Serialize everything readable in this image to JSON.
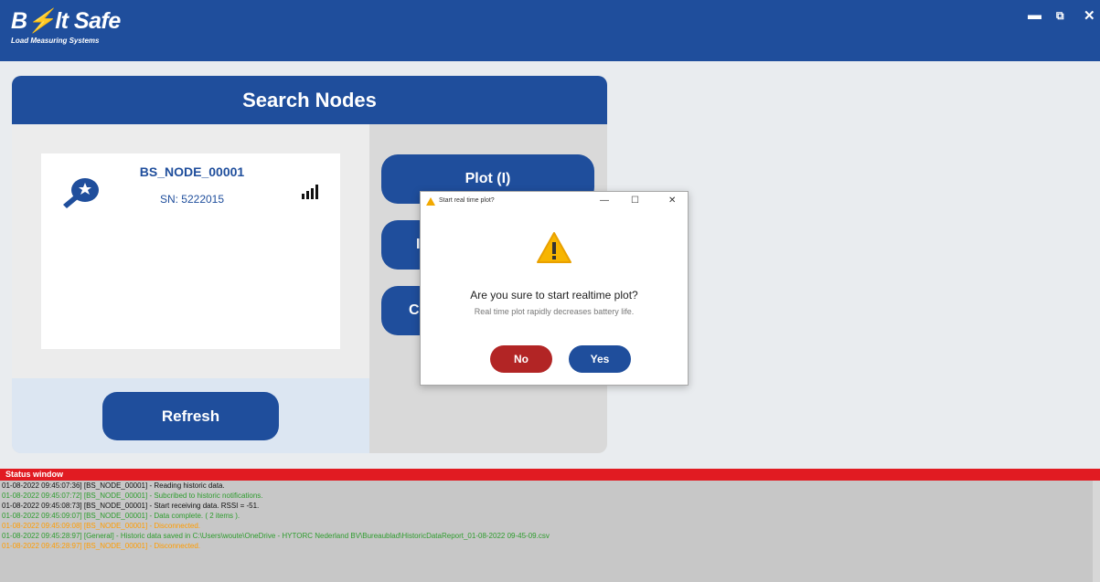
{
  "app": {
    "logo_prefix": "B",
    "logo_suffix": "lt Safe",
    "logo_subtitle": "Load Measuring Systems",
    "window_controls": {
      "minimize": "▬",
      "restore": "⧉",
      "close": "✕"
    }
  },
  "panel": {
    "title": "Search Nodes",
    "node": {
      "name": "BS_NODE_00001",
      "sn": "SN: 5222015",
      "icon": "sensor-node-icon",
      "signal_icon": "signal-strength-icon"
    },
    "refresh_label": "Refresh",
    "buttons": {
      "plot": "Plot (I)",
      "second": "I",
      "third": "C"
    }
  },
  "dialog": {
    "title": "Start real time plot?",
    "question": "Are you sure to start realtime plot?",
    "detail": "Real time plot rapidly decreases battery life.",
    "no_label": "No",
    "yes_label": "Yes",
    "controls": {
      "minimize": "—",
      "maximize": "☐",
      "close": "✕"
    }
  },
  "status": {
    "title": "Status window",
    "lines": [
      {
        "text": "01-08-2022 09:45:07:36] [BS_NODE_00001] - Reading historic data.",
        "color": "black"
      },
      {
        "text": "01-08-2022 09:45:07:72] [BS_NODE_00001] - Subcribed to historic notifications.",
        "color": "green"
      },
      {
        "text": "01-08-2022 09:45:08:73] [BS_NODE_00001] - Start receiving data. RSSI = -51.",
        "color": "black"
      },
      {
        "text": "01-08-2022 09:45:09:07] [BS_NODE_00001] - Data complete. ( 2 items ).",
        "color": "green"
      },
      {
        "text": "01-08-2022 09:45:09:08] [BS_NODE_00001] - Disconnected.",
        "color": "orange"
      },
      {
        "text": "01-08-2022 09:45:28:97] [General] - Historic data saved in C:\\Users\\woute\\OneDrive - HYTORC Nederland BV\\Bureaublad\\HistoricDataReport_01-08-2022 09-45-09.csv",
        "color": "green"
      },
      {
        "text": "01-08-2022 09:45:28:97] [BS_NODE_00001] - Disconnected.",
        "color": "orange"
      }
    ]
  }
}
